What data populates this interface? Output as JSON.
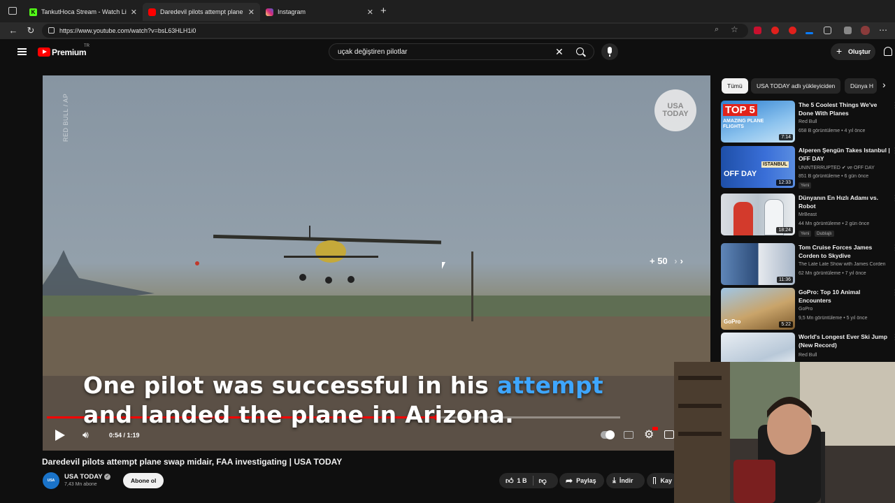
{
  "browser": {
    "tabs": [
      {
        "title": "TankutHoca Stream - Watch Live",
        "favicon_color": "#53fc18",
        "active": false
      },
      {
        "title": "Daredevil pilots attempt plane swa",
        "favicon_color": "#ff0000",
        "active": true
      },
      {
        "title": "Instagram",
        "favicon_color": "#d6249f",
        "active": false
      }
    ],
    "url": "https://www.youtube.com/watch?v=bsL63HLH1i0"
  },
  "youtube": {
    "logo_text": "Premium",
    "region": "TR",
    "search_value": "uçak değiştiren pilotlar",
    "create_label": "Oluştur"
  },
  "player": {
    "watermark": "RED BULL / AP",
    "channel_logo_line1": "USA",
    "channel_logo_line2": "TODAY",
    "seek_label": "+ 50",
    "caption_line1_a": "One pilot was successful in his ",
    "caption_line1_b": "attempt",
    "caption_line2": "and landed the plane in Arizona.",
    "time": "0:54 / 1:19",
    "progress": 0.68
  },
  "video": {
    "title": "Daredevil pilots attempt plane swap midair, FAA investigating | USA TODAY",
    "channel": "USA TODAY",
    "subscribers": "7,43 Mn abone",
    "subscribe_label": "Abone ol",
    "likes": "1 B",
    "share_label": "Paylaş",
    "download_label": "İndir",
    "save_label": "Kay"
  },
  "chips": [
    "Tümü",
    "USA TODAY adlı yükleyiciden",
    "Dünya H"
  ],
  "recommendations": [
    {
      "title": "The 5 Coolest Things We've Done With Planes",
      "channel": "Red Bull",
      "meta": "658 B görüntüleme • 4 yıl önce",
      "duration": "7:14",
      "thumb_text": "TOP 5",
      "thumb_sub": "AMAZING PLANE FLIGHTS",
      "badges": []
    },
    {
      "title": "Alperen Şengün Takes Istanbul | OFF DAY",
      "channel": "UNINTERRUPTED ✔ ve OFF DAY",
      "meta": "851 B görüntüleme • 6 gün önce",
      "duration": "12:33",
      "thumb_text": "OFF DAY",
      "thumb_sub": "ISTANBUL",
      "badges": [
        "Yeni"
      ]
    },
    {
      "title": "Dünyanın En Hızlı Adamı vs. Robot",
      "channel": "MrBeast",
      "meta": "44 Mn görüntüleme • 2 gün önce",
      "duration": "18:24",
      "thumb_text": "",
      "thumb_sub": "",
      "badges": [
        "Yeni",
        "Dublajlı"
      ]
    },
    {
      "title": "Tom Cruise Forces James Corden to Skydive",
      "channel": "The Late Late Show with James Corden",
      "meta": "62 Mn görüntüleme • 7 yıl önce",
      "duration": "11:36",
      "thumb_text": "",
      "thumb_sub": "",
      "badges": []
    },
    {
      "title": "GoPro: Top 10 Animal Encounters",
      "channel": "GoPro",
      "meta": "9,5 Mn görüntüleme • 5 yıl önce",
      "duration": "5:22",
      "thumb_text": "GoPro",
      "thumb_sub": "",
      "badges": []
    },
    {
      "title": "World's Longest Ever Ski Jump (New Record)",
      "channel": "Red Bull",
      "meta": "",
      "duration": "",
      "thumb_text": "",
      "thumb_sub": "",
      "badges": []
    }
  ]
}
